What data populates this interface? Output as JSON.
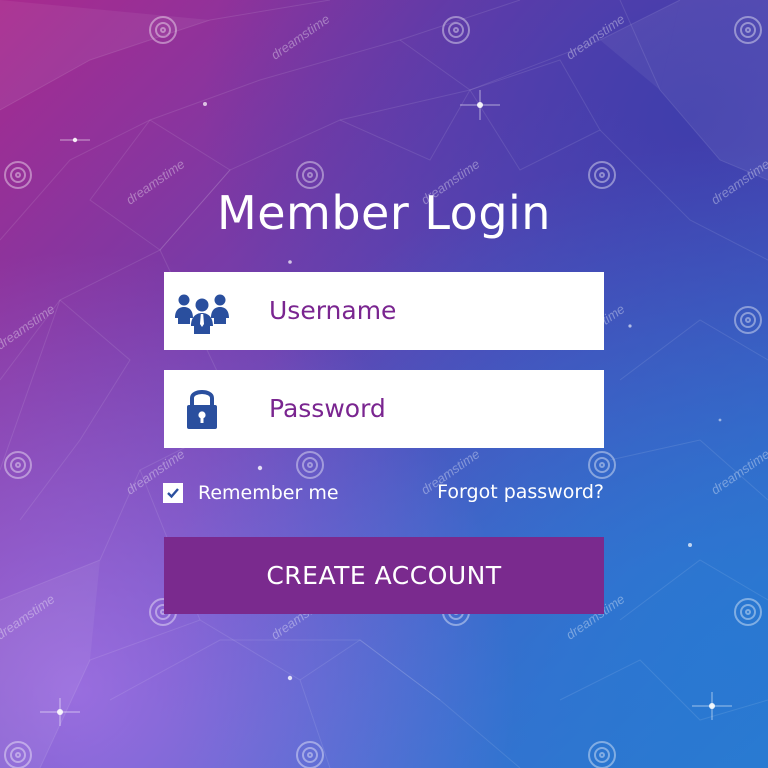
{
  "form": {
    "title": "Member Login",
    "username_placeholder": "Username",
    "password_placeholder": "Password",
    "remember_label": "Remember me",
    "remember_checked": true,
    "forgot_label": "Forgot password?",
    "submit_label": "CREATE ACCOUNT"
  },
  "icons": {
    "username": "users-group-icon",
    "password": "padlock-icon",
    "checkbox": "checkmark-icon"
  },
  "colors": {
    "field_text": "#7a2590",
    "icon_blue": "#2a4f9e",
    "button_bg": "#7a2a8e",
    "text_white": "#ffffff"
  },
  "watermark": {
    "text": "dreamstime"
  }
}
